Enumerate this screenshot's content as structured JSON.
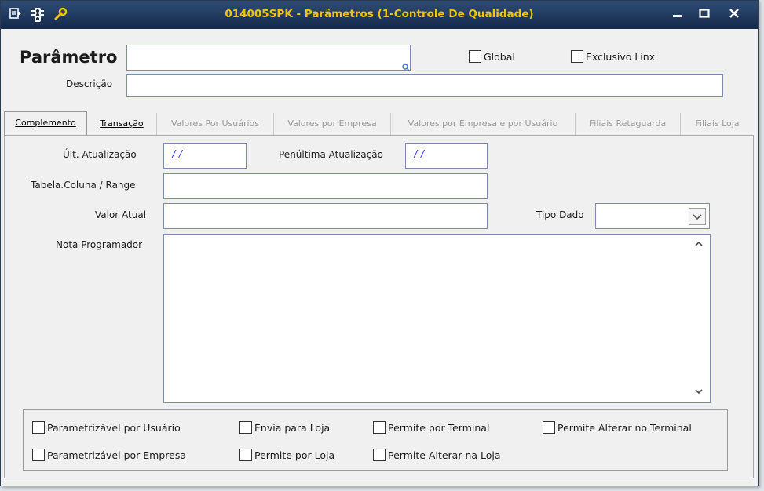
{
  "window": {
    "title": "014005SPK - Parâmetros (1-Controle De Qualidade)",
    "icons": [
      "menu-icon",
      "traffic-light-icon",
      "wrench-icon"
    ],
    "controls": [
      "minimize",
      "maximize",
      "close"
    ]
  },
  "header": {
    "parametro_label": "Parâmetro",
    "parametro_value": "",
    "descricao_label": "Descrição",
    "descricao_value": "",
    "global_label": "Global",
    "exclusivo_label": "Exclusivo Linx"
  },
  "tabs": [
    {
      "label": "Complemento"
    },
    {
      "label": "Transação"
    },
    {
      "label": "Valores Por Usuários"
    },
    {
      "label": "Valores por Empresa"
    },
    {
      "label": "Valores por Empresa e por Usuário"
    },
    {
      "label": "Filiais Retaguarda"
    },
    {
      "label": "Filiais Loja"
    }
  ],
  "form": {
    "ult_atualizacao_label": "Últ. Atualização",
    "ult_atualizacao_value": "/ /",
    "penultima_label": "Penúltima Atualização",
    "penultima_value": "/ /",
    "tabela_label": "Tabela.Coluna / Range",
    "tabela_value": "",
    "valor_atual_label": "Valor Atual",
    "valor_atual_value": "",
    "tipo_dado_label": "Tipo Dado",
    "tipo_dado_value": "",
    "nota_label": "Nota Programador",
    "nota_value": ""
  },
  "options": {
    "row1": [
      "Parametrizável por Usuário",
      "Envia para Loja",
      "Permite por Terminal",
      "Permite Alterar no Terminal"
    ],
    "row2": [
      "Parametrizável por Empresa",
      "Permite por Loja",
      "Permite Alterar na Loja"
    ]
  }
}
